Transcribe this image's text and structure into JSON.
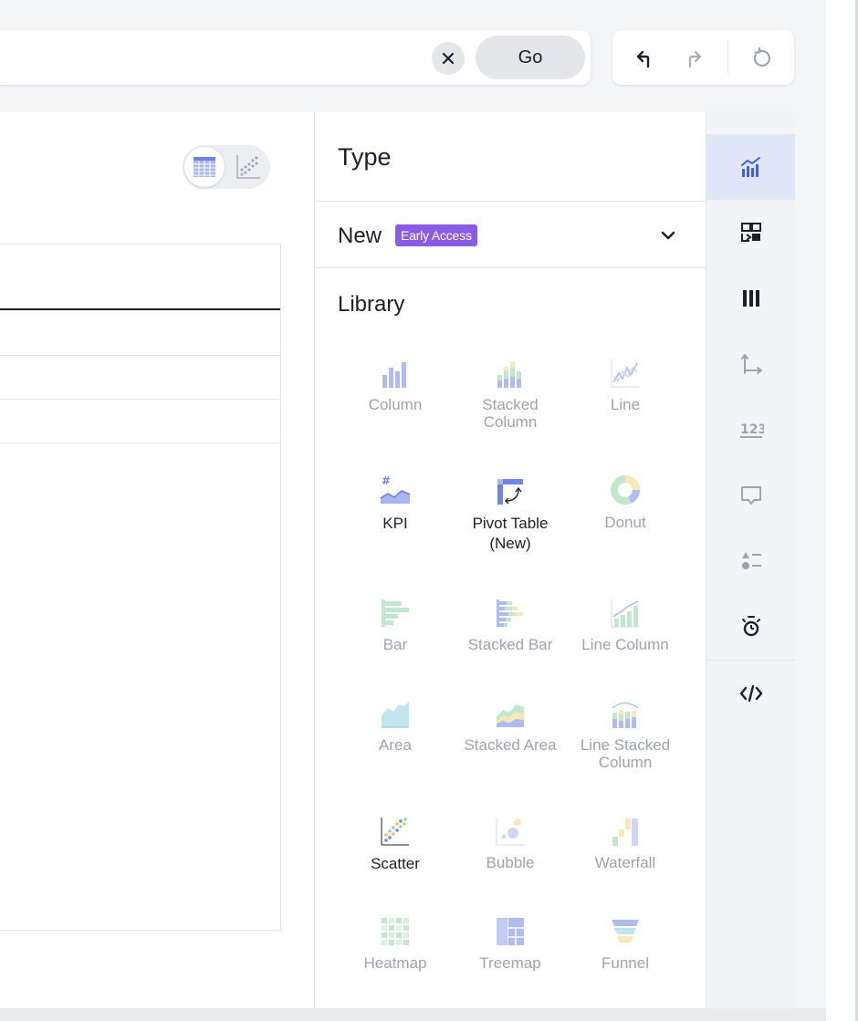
{
  "search": {
    "go_label": "Go",
    "clear_icon": "close-icon"
  },
  "history": {
    "undo_icon": "undo-arrow-icon",
    "redo_icon": "redo-arrow-icon",
    "reset_icon": "reset-icon"
  },
  "view_toggle": {
    "options": [
      "table-view-icon",
      "chart-view-icon"
    ],
    "selected": "table-view-icon"
  },
  "type_panel": {
    "title": "Type",
    "new_section": {
      "label": "New",
      "badge": "Early Access"
    },
    "library_title": "Library",
    "charts": [
      {
        "label": "Column",
        "icon": "column-chart-icon",
        "enabled": false
      },
      {
        "label": "Stacked Column",
        "icon": "stacked-column-chart-icon",
        "enabled": false
      },
      {
        "label": "Line",
        "icon": "line-chart-icon",
        "enabled": false
      },
      {
        "label": "KPI",
        "icon": "kpi-chart-icon",
        "enabled": true
      },
      {
        "label": "Pivot Table (New)",
        "icon": "pivot-table-icon",
        "enabled": true
      },
      {
        "label": "Donut",
        "icon": "donut-chart-icon",
        "enabled": false
      },
      {
        "label": "Bar",
        "icon": "bar-chart-icon",
        "enabled": false
      },
      {
        "label": "Stacked Bar",
        "icon": "stacked-bar-chart-icon",
        "enabled": false
      },
      {
        "label": "Line Column",
        "icon": "line-column-chart-icon",
        "enabled": false
      },
      {
        "label": "Area",
        "icon": "area-chart-icon",
        "enabled": false
      },
      {
        "label": "Stacked Area",
        "icon": "stacked-area-chart-icon",
        "enabled": false
      },
      {
        "label": "Line Stacked Column",
        "icon": "line-stacked-column-chart-icon",
        "enabled": false
      },
      {
        "label": "Scatter",
        "icon": "scatter-chart-icon",
        "enabled": true
      },
      {
        "label": "Bubble",
        "icon": "bubble-chart-icon",
        "enabled": false
      },
      {
        "label": "Waterfall",
        "icon": "waterfall-chart-icon",
        "enabled": false
      },
      {
        "label": "Heatmap",
        "icon": "heatmap-chart-icon",
        "enabled": false
      },
      {
        "label": "Treemap",
        "icon": "treemap-chart-icon",
        "enabled": false
      },
      {
        "label": "Funnel",
        "icon": "funnel-chart-icon",
        "enabled": false
      }
    ]
  },
  "side_rail": {
    "items": [
      {
        "icon": "chart-type-icon",
        "active": true
      },
      {
        "icon": "configure-icon",
        "active": false
      },
      {
        "icon": "columns-icon",
        "active": false
      },
      {
        "icon": "axes-icon",
        "active": false
      },
      {
        "icon": "number-format-icon",
        "active": false
      },
      {
        "icon": "tooltip-icon",
        "active": false
      },
      {
        "icon": "legend-icon",
        "active": false
      },
      {
        "icon": "analytics-icon",
        "active": false
      },
      {
        "icon": "embed-code-icon",
        "active": false
      }
    ]
  },
  "colors": {
    "accent": "#8c5be3",
    "rail_active": "#e0e5f7",
    "chart_blue": "#6f85e6"
  }
}
